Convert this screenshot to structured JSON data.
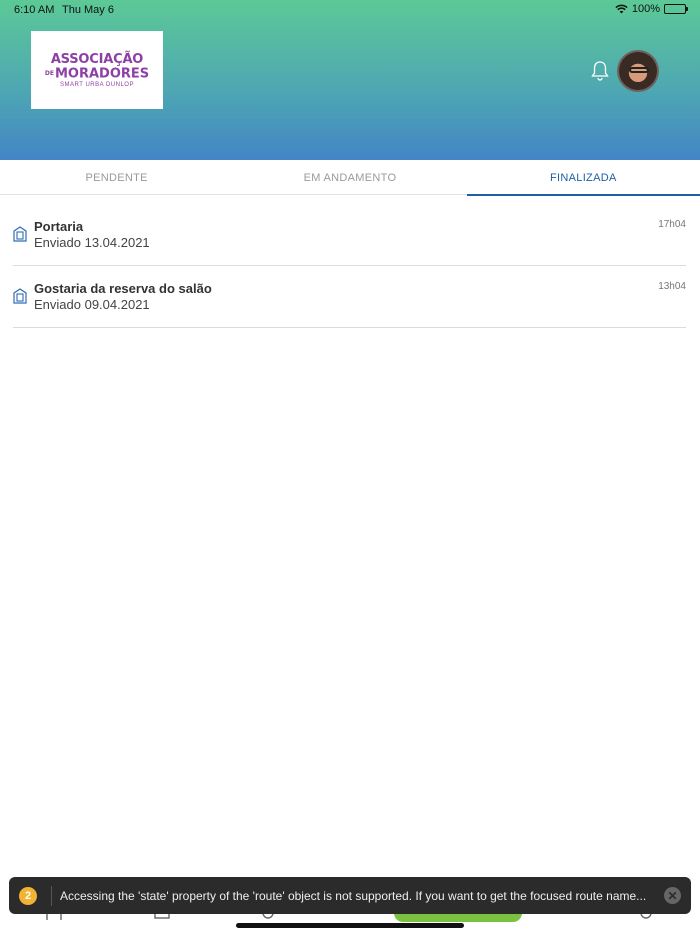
{
  "status_bar": {
    "time": "6:10 AM",
    "date": "Thu May 6",
    "battery": "100%"
  },
  "logo": {
    "line1": "ASSOCIAÇÃO",
    "line2_prefix": "DE",
    "line2": "MORADORES",
    "line3": "SMART URBA DUNLOP"
  },
  "tabs": [
    {
      "label": "PENDENTE",
      "active": false
    },
    {
      "label": "EM ANDAMENTO",
      "active": false
    },
    {
      "label": "FINALIZADA",
      "active": true
    }
  ],
  "items": [
    {
      "title": "Portaria",
      "subtitle": "Enviado 13.04.2021",
      "time": "17h04",
      "icon": "building-icon"
    },
    {
      "title": "Gostaria da reserva do salão",
      "subtitle": "Enviado 09.04.2021",
      "time": "13h04",
      "icon": "building-icon"
    }
  ],
  "toast": {
    "count": "2",
    "message": "Accessing the 'state' property of the 'route' object is not supported. If you want to get the focused route name..."
  },
  "colors": {
    "accent": "#1f5fa6",
    "header_top": "#5cc996",
    "header_bottom": "#4385c6",
    "logo_purple": "#8e3fa6",
    "fab_green": "#7cc242"
  }
}
